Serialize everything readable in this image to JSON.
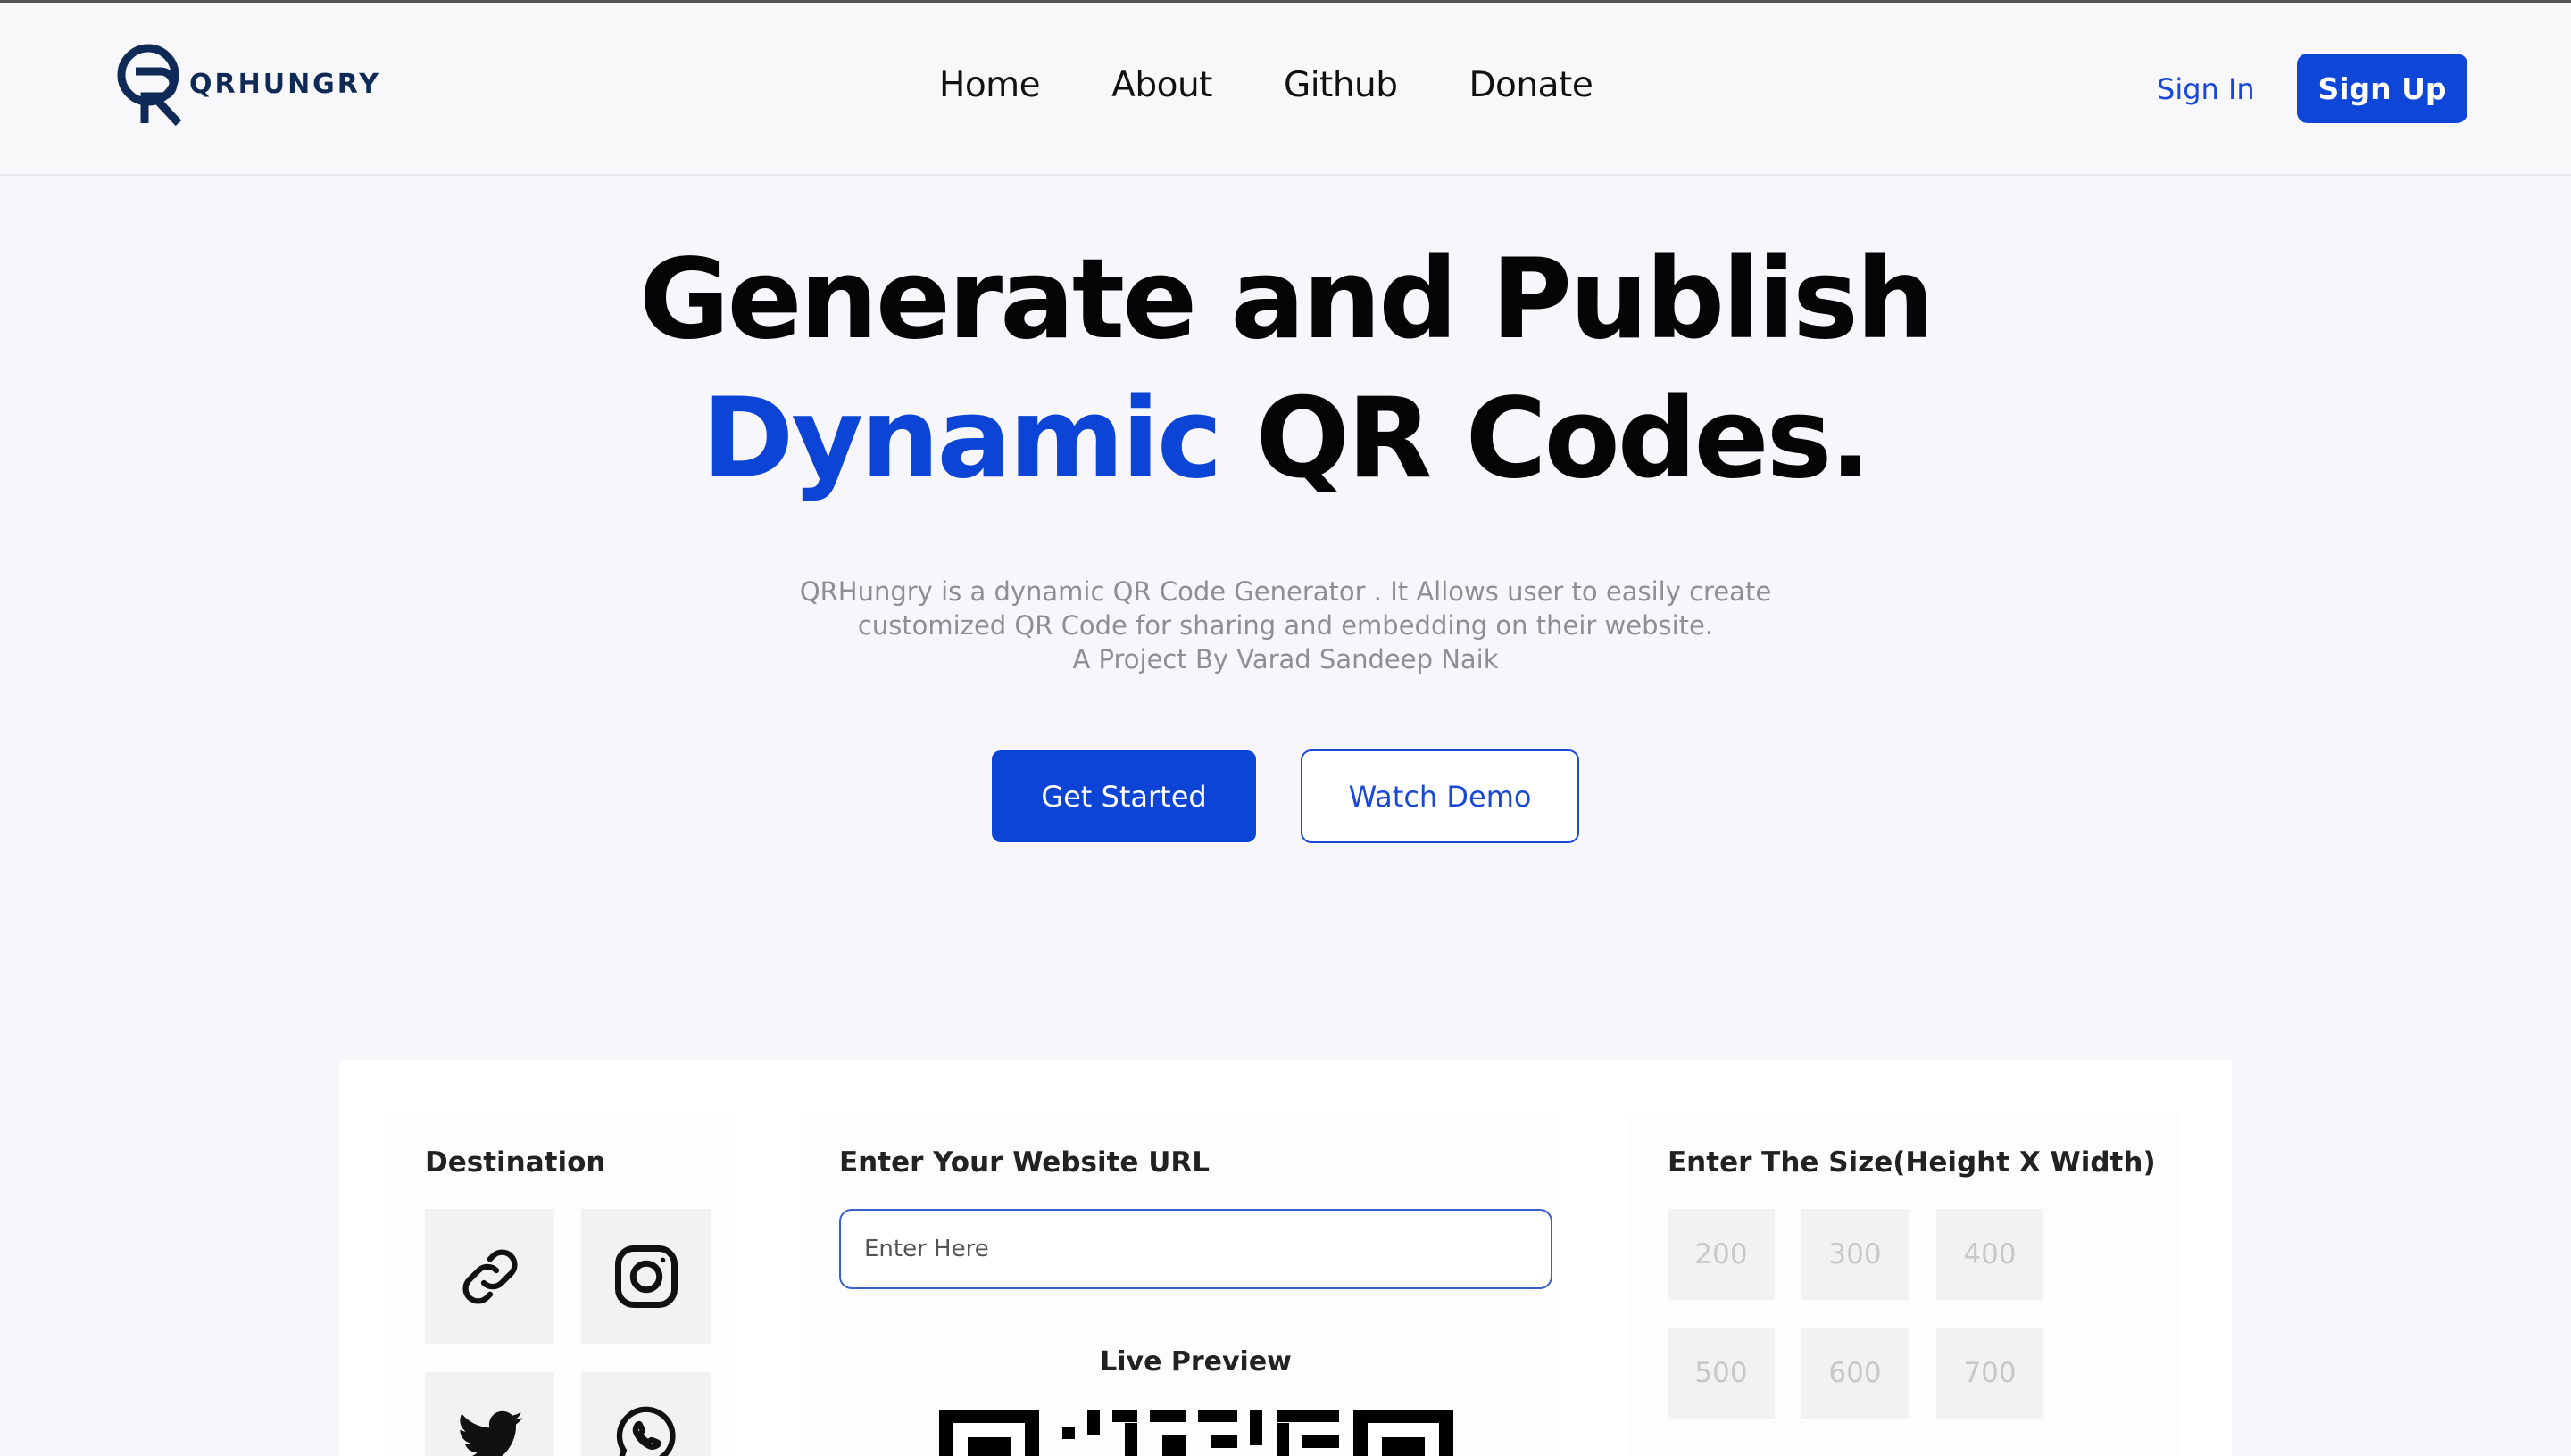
{
  "brand": {
    "name": "QRHUNGRY",
    "accent_color": "#0c44d6",
    "logo_color": "#0f2a57"
  },
  "nav": {
    "links": [
      "Home",
      "About",
      "Github",
      "Donate"
    ],
    "signin_label": "Sign In",
    "signup_label": "Sign Up"
  },
  "hero": {
    "title_line1": "Generate and Publish",
    "title_accent": "Dynamic",
    "title_rest": " QR Codes.",
    "desc_line1": "QRHungry is a dynamic QR Code Generator . It Allows user to easily create",
    "desc_line2": "customized QR Code for sharing and embedding on their website.",
    "desc_line3": "A Project By Varad Sandeep Naik",
    "get_started_label": "Get Started",
    "watch_demo_label": "Watch Demo"
  },
  "generator": {
    "destination_title": "Destination",
    "destinations": [
      "link-icon",
      "instagram-icon",
      "twitter-icon",
      "whatsapp-icon"
    ],
    "url_title": "Enter Your Website URL",
    "url_placeholder": "Enter Here",
    "url_value": "",
    "live_preview_label": "Live Preview",
    "size_title": "Enter The Size(Height X Width)",
    "sizes": [
      "200",
      "300",
      "400",
      "500",
      "600",
      "700"
    ]
  }
}
